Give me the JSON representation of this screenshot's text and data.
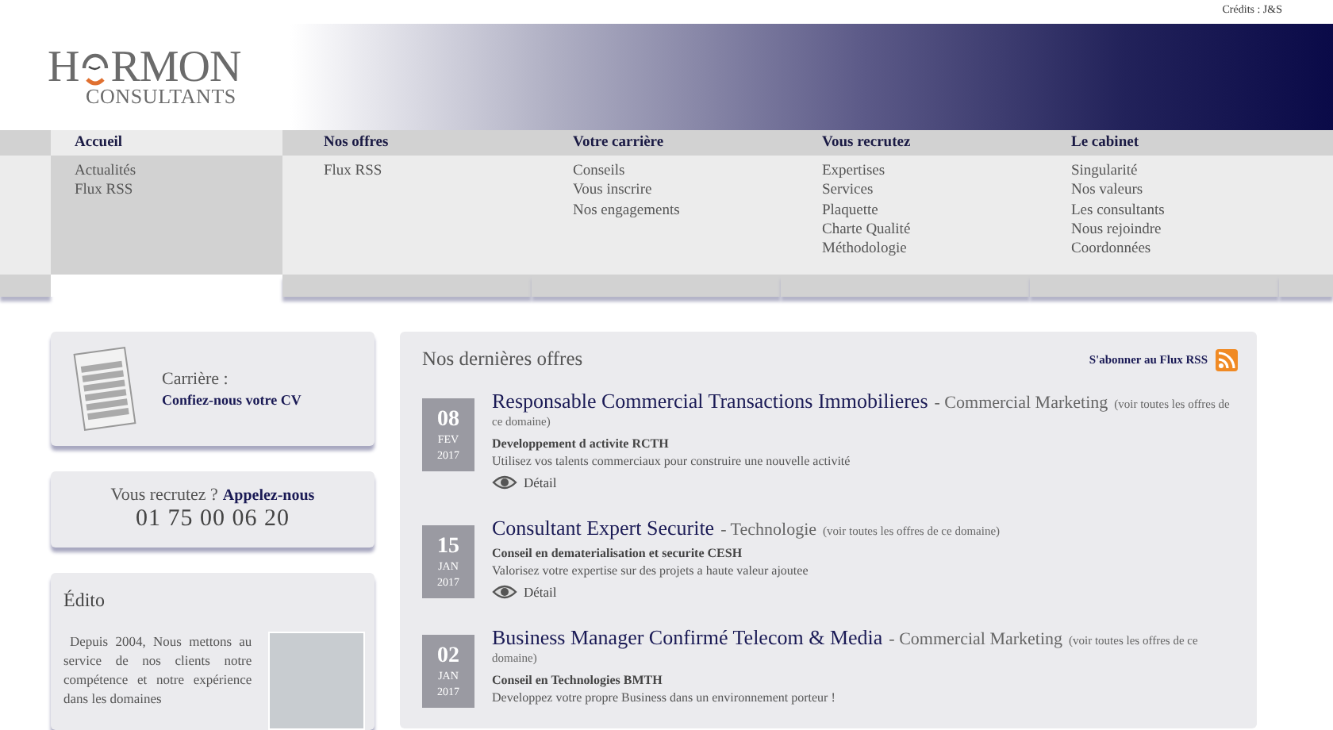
{
  "credits": "Crédits : J&S",
  "logo": {
    "start": "H",
    "end": "RMON",
    "tagline": "CONSULTANTS"
  },
  "nav": [
    {
      "heading": "Accueil",
      "selected": true,
      "items": [
        "Actualités",
        "Flux RSS"
      ]
    },
    {
      "heading": "Nos offres",
      "selected": false,
      "items": [
        "Flux RSS"
      ]
    },
    {
      "heading": "Votre carrière",
      "selected": false,
      "items": [
        "Conseils",
        "Vous inscrire",
        "Nos engagements"
      ]
    },
    {
      "heading": "Vous recrutez",
      "selected": false,
      "items": [
        "Expertises",
        "Services",
        "Plaquette",
        "Charte Qualité",
        "Méthodologie"
      ]
    },
    {
      "heading": "Le cabinet",
      "selected": false,
      "items": [
        "Singularité",
        "Nos valeurs",
        "Les consultants",
        "Nous rejoindre",
        "Coordonnées"
      ]
    }
  ],
  "cv_card": {
    "title": "Carrière :",
    "link": "Confiez-nous votre CV"
  },
  "recruit_card": {
    "question": "Vous recrutez ?",
    "link": "Appelez-nous",
    "phone": "01 75 00 06 20"
  },
  "edito": {
    "title": "Édito",
    "text": "Depuis 2004, Nous mettons au service de nos clients notre compétence et notre expérience dans les domaines"
  },
  "offers_panel": {
    "title": "Nos dernières offres",
    "rss_link": "S'abonner au Flux RSS",
    "offers": [
      {
        "day": "08",
        "month": "FEV",
        "year": "2017",
        "title": "Responsable Commercial Transactions Immobilieres",
        "domain": "- Commercial Marketing",
        "domain_link": "(voir toutes les offres de ce domaine)",
        "company": "Developpement d activite RCTH",
        "summary": "Utilisez vos talents commerciaux pour construire une nouvelle activité",
        "detail": "Détail"
      },
      {
        "day": "15",
        "month": "JAN",
        "year": "2017",
        "title": "Consultant Expert Securite",
        "domain": "- Technologie",
        "domain_link": "(voir toutes les offres de ce domaine)",
        "company": "Conseil en dematerialisation et securite CESH",
        "summary": "Valorisez votre expertise sur des projets a haute valeur ajoutee",
        "detail": "Détail"
      },
      {
        "day": "02",
        "month": "JAN",
        "year": "2017",
        "title": "Business Manager Confirmé Telecom & Media",
        "domain": "- Commercial Marketing",
        "domain_link": "(voir toutes les offres de ce domaine)",
        "company": "Conseil en Technologies BMTH",
        "summary": "Developpez votre propre Business dans un environnement porteur !"
      }
    ]
  }
}
